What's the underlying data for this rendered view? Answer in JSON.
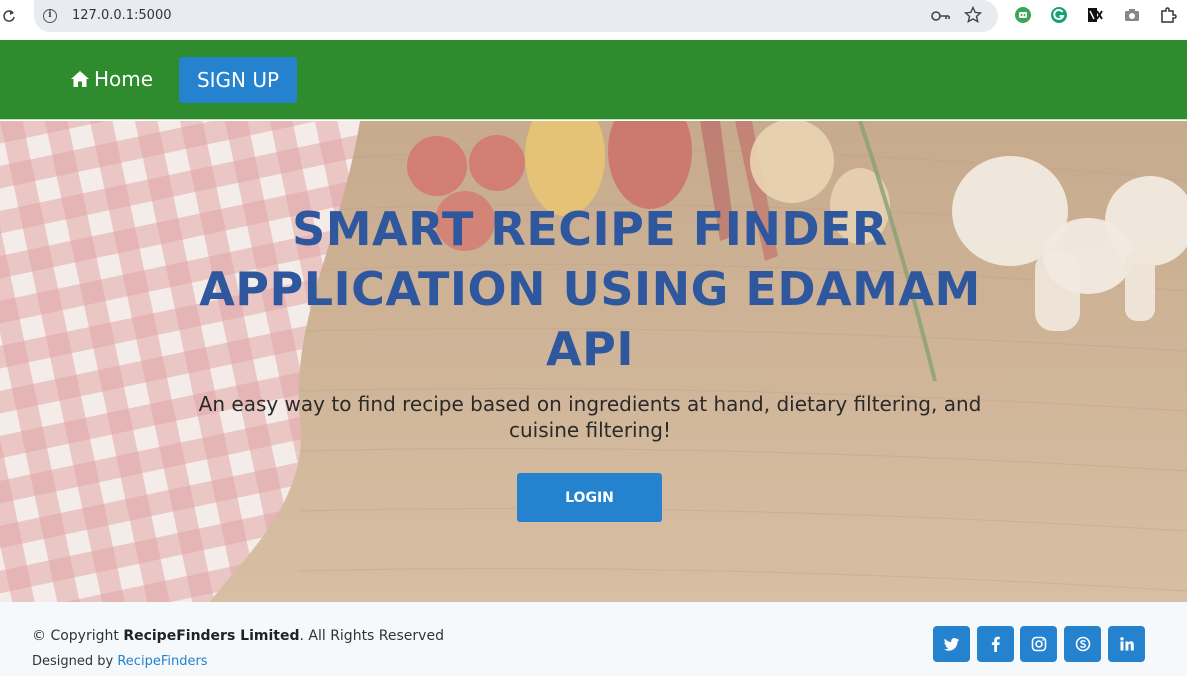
{
  "browser": {
    "url": "127.0.0.1:5000",
    "icons": [
      "reload-icon",
      "site-info-icon",
      "key-icon",
      "star-icon",
      "extension-icons",
      "puzzle-icon"
    ]
  },
  "nav": {
    "home_label": "Home",
    "signup_label": "SIGN UP"
  },
  "hero": {
    "title": "SMART RECIPE FINDER APPLICATION USING EDAMAM API",
    "subtitle": "An easy way to find recipe based on ingredients at hand, dietary filtering, and cuisine filtering!",
    "login_label": "LOGIN"
  },
  "footer": {
    "copyright_prefix": "© Copyright",
    "company": "RecipeFinders Limited",
    "copyright_suffix": ". All Rights Reserved",
    "designed_prefix": "Designed by",
    "designer": "RecipeFinders",
    "social": [
      "twitter-icon",
      "facebook-icon",
      "instagram-icon",
      "skype-icon",
      "linkedin-icon"
    ]
  },
  "colors": {
    "nav_bg": "#2e8b2e",
    "primary_blue": "#2482cf",
    "title_blue": "#2f579e",
    "footer_bg": "#f5f9fc"
  }
}
